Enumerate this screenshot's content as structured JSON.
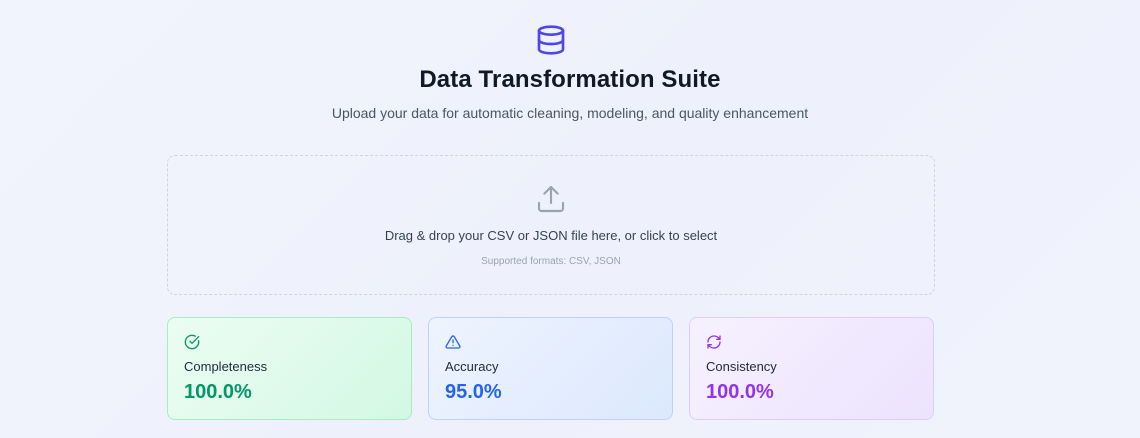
{
  "header": {
    "logo_icon": "database-icon",
    "title": "Data Transformation Suite",
    "subtitle": "Upload your data for automatic cleaning, modeling, and quality enhancement"
  },
  "dropzone": {
    "icon": "upload-icon",
    "text": "Drag & drop your CSV or JSON file here, or click to select",
    "formats": "Supported formats: CSV, JSON"
  },
  "metrics": [
    {
      "icon": "check-circle-icon",
      "label": "Completeness",
      "value": "100.0%",
      "color": "#059669"
    },
    {
      "icon": "alert-triangle-icon",
      "label": "Accuracy",
      "value": "95.0%",
      "color": "#2563eb"
    },
    {
      "icon": "refresh-icon",
      "label": "Consistency",
      "value": "100.0%",
      "color": "#9333ea"
    }
  ],
  "colors": {
    "brand": "#4f46e5"
  }
}
